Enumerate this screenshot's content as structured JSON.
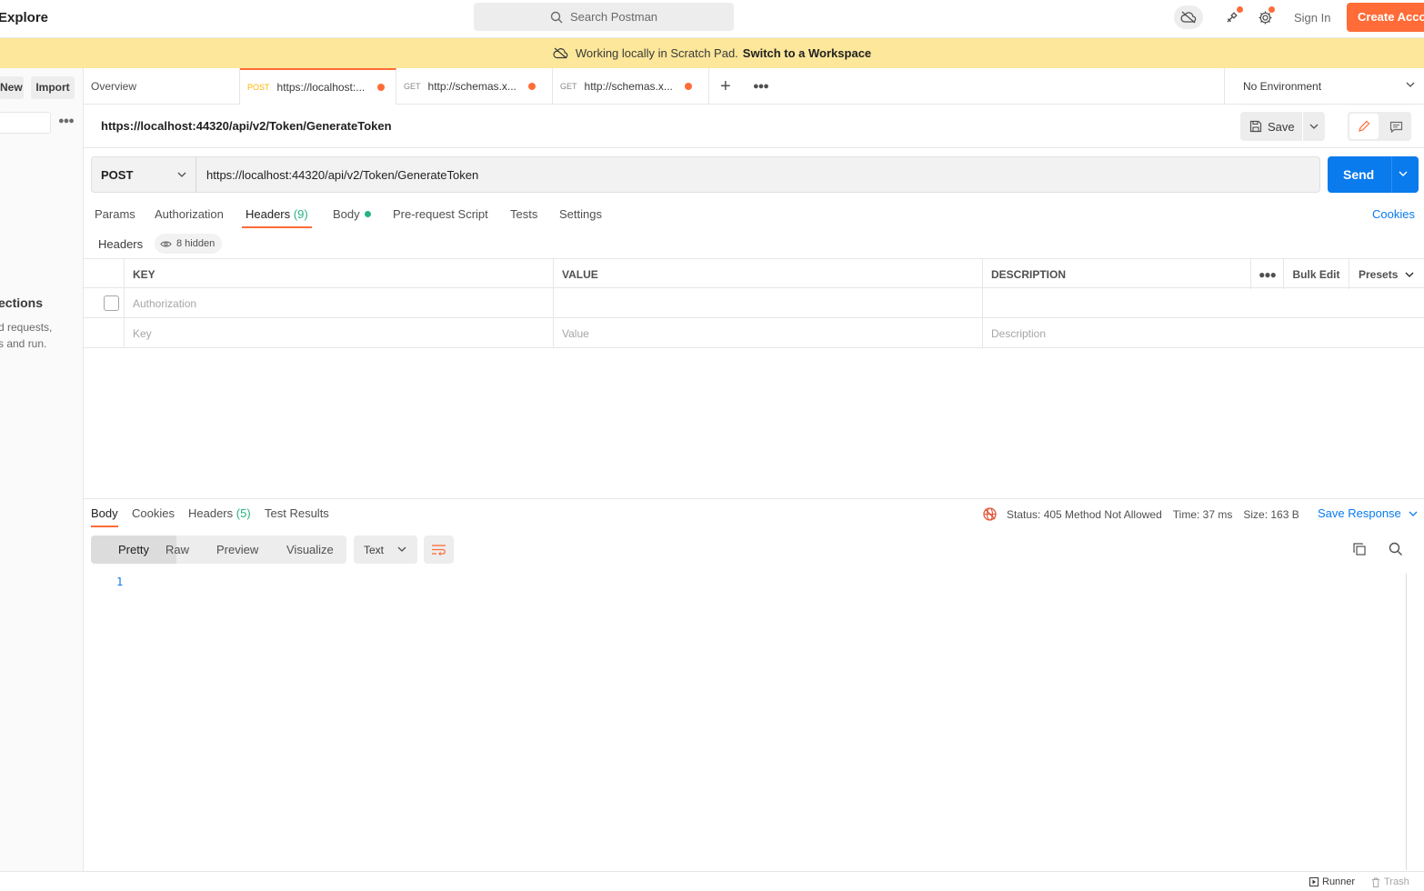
{
  "topbar": {
    "explore": "Explore",
    "search_placeholder": "Search Postman",
    "sign_in": "Sign In",
    "create_account": "Create Account"
  },
  "banner": {
    "text": "Working locally in Scratch Pad.",
    "link": "Switch to a Workspace"
  },
  "sidebar": {
    "new_label": "New",
    "import_label": "Import",
    "empty_title": "ections",
    "empty_desc": "d requests,\ns and run."
  },
  "tabs": {
    "overview": "Overview",
    "items": [
      {
        "method": "POST",
        "url": "https://localhost:..."
      },
      {
        "method": "GET",
        "url": "http://schemas.x..."
      },
      {
        "method": "GET",
        "url": "http://schemas.x..."
      }
    ],
    "environment": "No Environment"
  },
  "request": {
    "title": "https://localhost:44320/api/v2/Token/GenerateToken",
    "save_label": "Save",
    "method": "POST",
    "url": "https://localhost:44320/api/v2/Token/GenerateToken",
    "send_label": "Send"
  },
  "request_tabs": {
    "params": "Params",
    "authorization": "Authorization",
    "headers": "Headers",
    "headers_count": "(9)",
    "body": "Body",
    "pre_request": "Pre-request Script",
    "tests": "Tests",
    "settings": "Settings",
    "cookies": "Cookies"
  },
  "headers_section": {
    "label": "Headers",
    "hidden": "8 hidden",
    "columns": {
      "key": "KEY",
      "value": "VALUE",
      "description": "DESCRIPTION"
    },
    "bulk_edit": "Bulk Edit",
    "presets": "Presets",
    "rows": [
      {
        "key": "Authorization",
        "value": "",
        "description": ""
      }
    ],
    "placeholders": {
      "key": "Key",
      "value": "Value",
      "description": "Description"
    }
  },
  "response": {
    "tabs": {
      "body": "Body",
      "cookies": "Cookies",
      "headers": "Headers",
      "headers_count": "(5)",
      "test_results": "Test Results"
    },
    "status": "Status: 405 Method Not Allowed",
    "time": "Time: 37 ms",
    "size": "Size: 163 B",
    "save_response": "Save Response",
    "views": {
      "pretty": "Pretty",
      "raw": "Raw",
      "preview": "Preview",
      "visualize": "Visualize"
    },
    "format": "Text",
    "line_number": "1"
  },
  "statusbar": {
    "runner": "Runner",
    "trash": "Trash"
  },
  "colors": {
    "accent": "#ff6c37",
    "primary": "#097bed",
    "banner": "#fce79a",
    "success": "#26b47f"
  }
}
